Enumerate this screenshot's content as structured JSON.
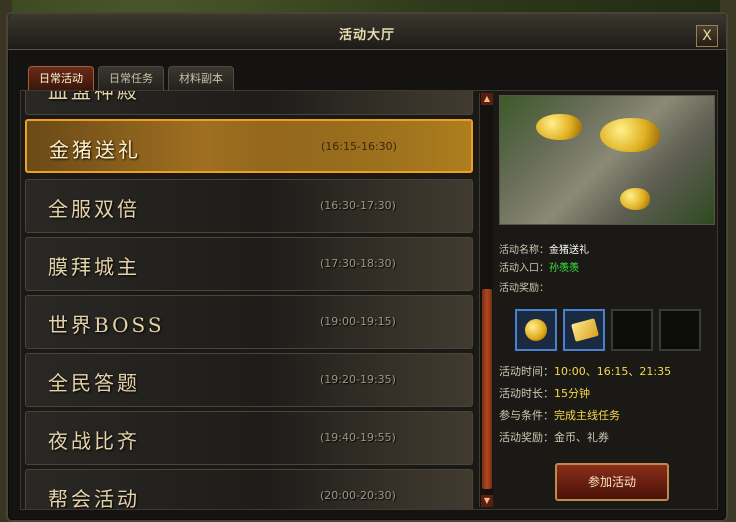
{
  "window": {
    "title": "活动大厅",
    "close_label": "X"
  },
  "tabs": [
    {
      "label": "日常活动",
      "active": true
    },
    {
      "label": "日常任务",
      "active": false
    },
    {
      "label": "材料副本",
      "active": false
    }
  ],
  "activities": [
    {
      "name": "血盟神殿",
      "time": ""
    },
    {
      "name": "金猪送礼",
      "time": "(16:15-16:30)"
    },
    {
      "name": "全服双倍",
      "time": "(16:30-17:30)"
    },
    {
      "name": "膜拜城主",
      "time": "(17:30-18:30)"
    },
    {
      "name": "世界BOSS",
      "time": "(19:00-19:15)"
    },
    {
      "name": "全民答题",
      "time": "(19:20-19:35)"
    },
    {
      "name": "夜战比齐",
      "time": "(19:40-19:55)"
    },
    {
      "name": "帮会活动",
      "time": "(20:00-20:30)"
    }
  ],
  "selected_activity": "金猪送礼",
  "detail": {
    "name_label": "活动名称：",
    "name_value": "金猪送礼",
    "entry_label": "活动入口：",
    "entry_value": "孙羡羡",
    "reward_label": "活动奖励：",
    "time_label": "活动时间：",
    "time_value": "10:00、16:15、21:35",
    "duration_label": "活动时长：",
    "duration_value": "15分钟",
    "condition_label": "参与条件：",
    "condition_value": "完成主线任务",
    "reward2_label": "活动奖励：",
    "reward2_value": "金币、礼券",
    "reward_items": [
      "gold-coin-icon",
      "voucher-icon"
    ],
    "join_button": "参加活动"
  },
  "colors": {
    "selected_border": "#f0a020",
    "join_button": "#8a2e18",
    "highlight_green": "#3ce63c",
    "highlight_yellow": "#f8d848"
  }
}
